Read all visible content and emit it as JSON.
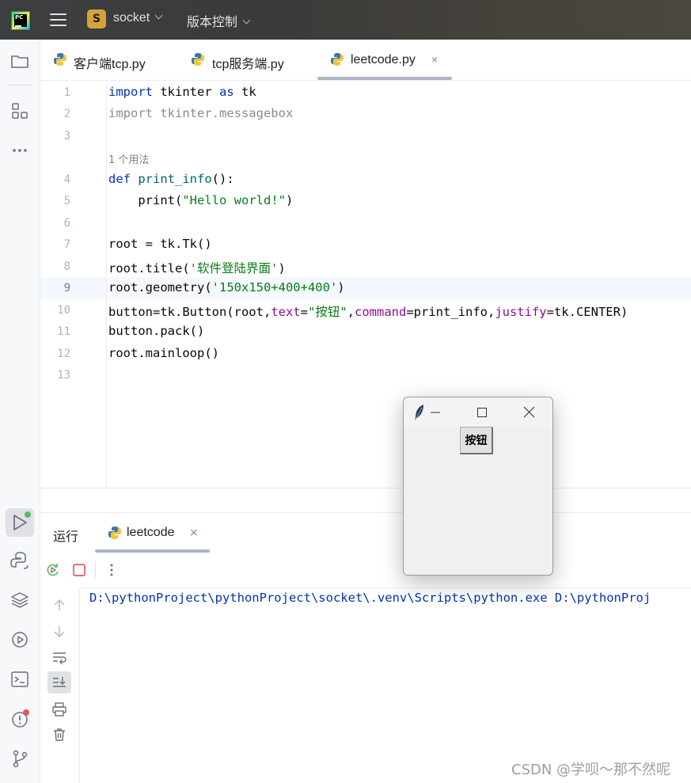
{
  "titlebar": {
    "project_badge": "S",
    "project_name": "socket",
    "vcs_label": "版本控制"
  },
  "tabs": [
    {
      "label": "客户端tcp.py"
    },
    {
      "label": "tcp服务端.py"
    },
    {
      "label": "leetcode.py",
      "close": "×"
    }
  ],
  "editor": {
    "line_numbers": [
      "1",
      "2",
      "3",
      "4",
      "5",
      "6",
      "7",
      "8",
      "9",
      "10",
      "11",
      "12",
      "13"
    ],
    "usage_hint": "1 个用法",
    "current_line": "9",
    "code": {
      "l1": [
        "import",
        " tkinter ",
        "as",
        " tk"
      ],
      "l2": "import tkinter.messagebox",
      "l4": [
        "def",
        " ",
        "print_info",
        "():"
      ],
      "l5": [
        "    print(",
        "\"Hello world!\"",
        ")"
      ],
      "l7": "root = tk.Tk()",
      "l8": [
        "root.title(",
        "'软件登陆界面'",
        ")"
      ],
      "l9": [
        "root.geometry(",
        "'150x150+400+400'",
        ")"
      ],
      "l10": [
        "button=tk.Button(root,",
        "text",
        "=",
        "\"按钮\"",
        ",",
        "command",
        "=print_info,",
        "justify",
        "=tk.CENTER)"
      ],
      "l11": "button.pack()",
      "l12": "root.mainloop()"
    }
  },
  "run_panel": {
    "title": "运行",
    "tab_label": "leetcode",
    "tab_close": "×",
    "output": "D:\\pythonProject\\pythonProject\\socket\\.venv\\Scripts\\python.exe D:\\pythonProj"
  },
  "tk_window": {
    "button_label": "按钮"
  },
  "watermark": "CSDN @学呗～那不然呢",
  "colors": {
    "keyword": "#0033b3",
    "string": "#067d17",
    "function": "#00627a",
    "param": "#871094",
    "accent_green": "#5fb865",
    "accent_red": "#e55765"
  },
  "icons": [
    "project-folder-icon",
    "structure-icon",
    "more-icon",
    "run-icon",
    "python-packages-icon",
    "layers-icon",
    "services-icon",
    "terminal-icon",
    "problems-icon",
    "git-icon",
    "rerun-icon",
    "stop-icon",
    "up-arrow-icon",
    "down-arrow-icon",
    "soft-wrap-icon",
    "scroll-to-end-icon",
    "print-icon",
    "trash-icon",
    "tk-feather-icon",
    "minimize-icon",
    "maximize-icon",
    "close-icon"
  ]
}
